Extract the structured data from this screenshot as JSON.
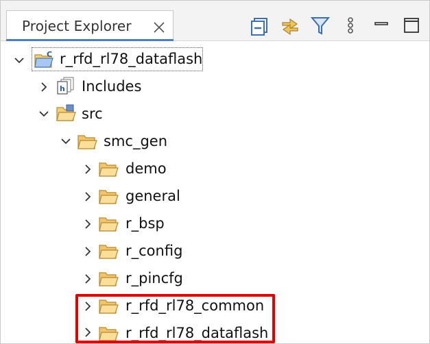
{
  "tab": {
    "title": "Project Explorer"
  },
  "toolbar": {
    "buttons": [
      {
        "name": "collapse-all-icon"
      },
      {
        "name": "link-with-editor-icon"
      },
      {
        "name": "filter-icon"
      },
      {
        "name": "view-menu-icon"
      },
      {
        "name": "minimize-icon"
      },
      {
        "name": "maximize-icon"
      }
    ]
  },
  "tree": {
    "project": {
      "label": "r_rfd_rl78_dataflash",
      "expanded": true,
      "icon": "c-project-icon"
    },
    "items": [
      {
        "label": "Includes",
        "expanded": false,
        "icon": "includes-icon"
      },
      {
        "label": "src",
        "expanded": true,
        "icon": "source-folder-icon"
      },
      {
        "label": "smc_gen",
        "expanded": true,
        "icon": "folder-icon"
      },
      {
        "label": "demo",
        "expanded": false,
        "icon": "folder-icon"
      },
      {
        "label": "general",
        "expanded": false,
        "icon": "folder-icon"
      },
      {
        "label": "r_bsp",
        "expanded": false,
        "icon": "folder-icon"
      },
      {
        "label": "r_config",
        "expanded": false,
        "icon": "folder-icon"
      },
      {
        "label": "r_pincfg",
        "expanded": false,
        "icon": "folder-icon"
      },
      {
        "label": "r_rfd_rl78_common",
        "expanded": false,
        "icon": "folder-icon"
      },
      {
        "label": "r_rfd_rl78_dataflash",
        "expanded": false,
        "icon": "folder-icon"
      }
    ]
  },
  "colors": {
    "highlight": "#e30000",
    "tab_accent": "#4a7dd0",
    "folder": "#f2c46b",
    "toolbar_icon": "#3a6fb0"
  }
}
